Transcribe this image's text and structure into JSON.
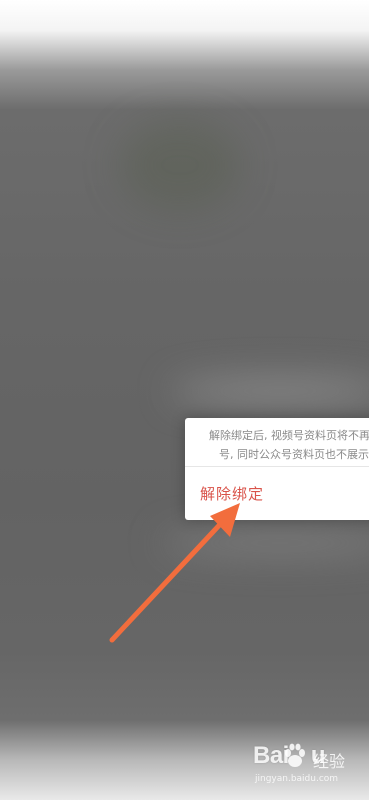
{
  "dialog": {
    "description_line1": "解除绑定后, 视频号资料页将不再",
    "description_line2": "号, 同时公众号资料页也不展示视",
    "unbind_label": "解除绑定"
  },
  "annotation": {
    "color": "#f26d3d",
    "icon": "arrow-icon"
  },
  "watermark": {
    "logo_part1": "Bai",
    "logo_part2": "u",
    "site_name": "经验",
    "url": "jingyan.baidu.com"
  }
}
